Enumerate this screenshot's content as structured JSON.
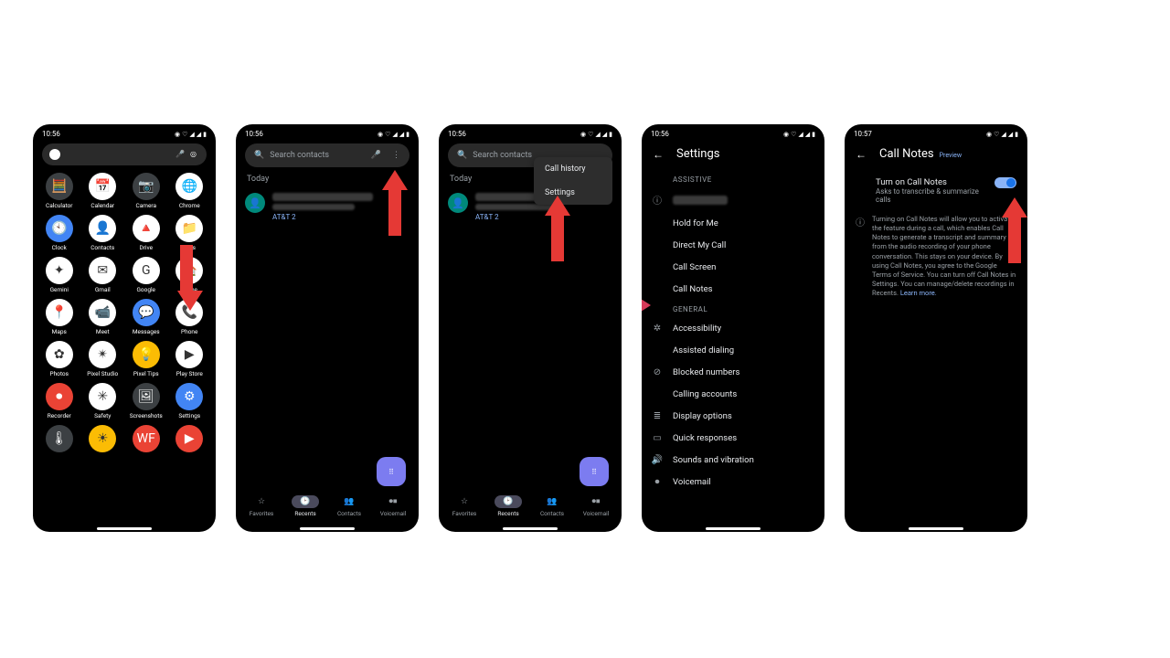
{
  "status": {
    "time1": "10:56",
    "time5": "10:57",
    "icons": "◉ ♡ ▲ ▲ ▮"
  },
  "home": {
    "apps": [
      {
        "label": "Calculator",
        "cls": "ic-dark",
        "glyph": "🧮"
      },
      {
        "label": "Calendar",
        "cls": "ic-white",
        "glyph": "📅"
      },
      {
        "label": "Camera",
        "cls": "ic-dark",
        "glyph": "📷"
      },
      {
        "label": "Chrome",
        "cls": "ic-white",
        "glyph": "🌐"
      },
      {
        "label": "Clock",
        "cls": "ic-blue",
        "glyph": "🕙"
      },
      {
        "label": "Contacts",
        "cls": "ic-white",
        "glyph": "👤"
      },
      {
        "label": "Drive",
        "cls": "ic-white",
        "glyph": "🔺"
      },
      {
        "label": "Files",
        "cls": "ic-white",
        "glyph": "📁"
      },
      {
        "label": "Gemini",
        "cls": "ic-white",
        "glyph": "✦"
      },
      {
        "label": "Gmail",
        "cls": "ic-white",
        "glyph": "✉"
      },
      {
        "label": "Google",
        "cls": "ic-white",
        "glyph": "G"
      },
      {
        "label": "Home",
        "cls": "ic-white",
        "glyph": "🏠"
      },
      {
        "label": "Maps",
        "cls": "ic-white",
        "glyph": "📍"
      },
      {
        "label": "Meet",
        "cls": "ic-white",
        "glyph": "📹"
      },
      {
        "label": "Messages",
        "cls": "ic-blue",
        "glyph": "💬"
      },
      {
        "label": "Phone",
        "cls": "ic-white",
        "glyph": "📞"
      },
      {
        "label": "Photos",
        "cls": "ic-white",
        "glyph": "✿"
      },
      {
        "label": "Pixel Studio",
        "cls": "ic-white",
        "glyph": "✴"
      },
      {
        "label": "Pixel Tips",
        "cls": "ic-yellow",
        "glyph": "💡"
      },
      {
        "label": "Play Store",
        "cls": "ic-white",
        "glyph": "▶"
      },
      {
        "label": "Recorder",
        "cls": "ic-red",
        "glyph": "⏺"
      },
      {
        "label": "Safety",
        "cls": "ic-white",
        "glyph": "✳"
      },
      {
        "label": "Screenshots",
        "cls": "ic-dark",
        "glyph": "🖼"
      },
      {
        "label": "Settings",
        "cls": "ic-blue",
        "glyph": "⚙"
      }
    ],
    "row6": [
      {
        "label": "",
        "cls": "ic-dark",
        "glyph": "🌡"
      },
      {
        "label": "",
        "cls": "ic-yellow",
        "glyph": "☀"
      },
      {
        "label": "",
        "cls": "ic-red",
        "glyph": "WF"
      },
      {
        "label": "",
        "cls": "ic-red",
        "glyph": "▶"
      }
    ]
  },
  "phoneapp": {
    "search_placeholder": "Search contacts",
    "today": "Today",
    "carrier": "AT&T 2",
    "tabs": [
      {
        "label": "Favorites",
        "glyph": "☆"
      },
      {
        "label": "Recents",
        "glyph": "🕑"
      },
      {
        "label": "Contacts",
        "glyph": "👥"
      },
      {
        "label": "Voicemail",
        "glyph": "⏺⏹"
      }
    ],
    "popup": {
      "history": "Call history",
      "settings": "Settings"
    }
  },
  "settings": {
    "title": "Settings",
    "assistive": "ASSISTIVE",
    "general": "GENERAL",
    "items_top": [
      "Hold for Me",
      "Direct My Call",
      "Call Screen",
      "Call Notes"
    ],
    "items_gen": [
      {
        "icon": "✲",
        "label": "Accessibility"
      },
      {
        "icon": "",
        "label": "Assisted dialing"
      },
      {
        "icon": "⊘",
        "label": "Blocked numbers"
      },
      {
        "icon": "",
        "label": "Calling accounts"
      },
      {
        "icon": "≣",
        "label": "Display options"
      },
      {
        "icon": "▭",
        "label": "Quick responses"
      },
      {
        "icon": "🔊",
        "label": "Sounds and vibration"
      },
      {
        "icon": "⏺",
        "label": "Voicemail"
      }
    ]
  },
  "callnotes": {
    "title": "Call Notes",
    "preview": "Preview",
    "toggle_title": "Turn on Call Notes",
    "toggle_sub": "Asks to transcribe & summarize calls",
    "info": "Turning on Call Notes will allow you to activate the feature during a call, which enables Call Notes to generate a transcript and summary from the audio recording of your phone conversation. This stays on your device. By using Call Notes, you agree to the Google Terms of Service. You can turn off Call Notes in Settings. You can manage/delete recordings in Recents.",
    "learn_more": "Learn more."
  }
}
